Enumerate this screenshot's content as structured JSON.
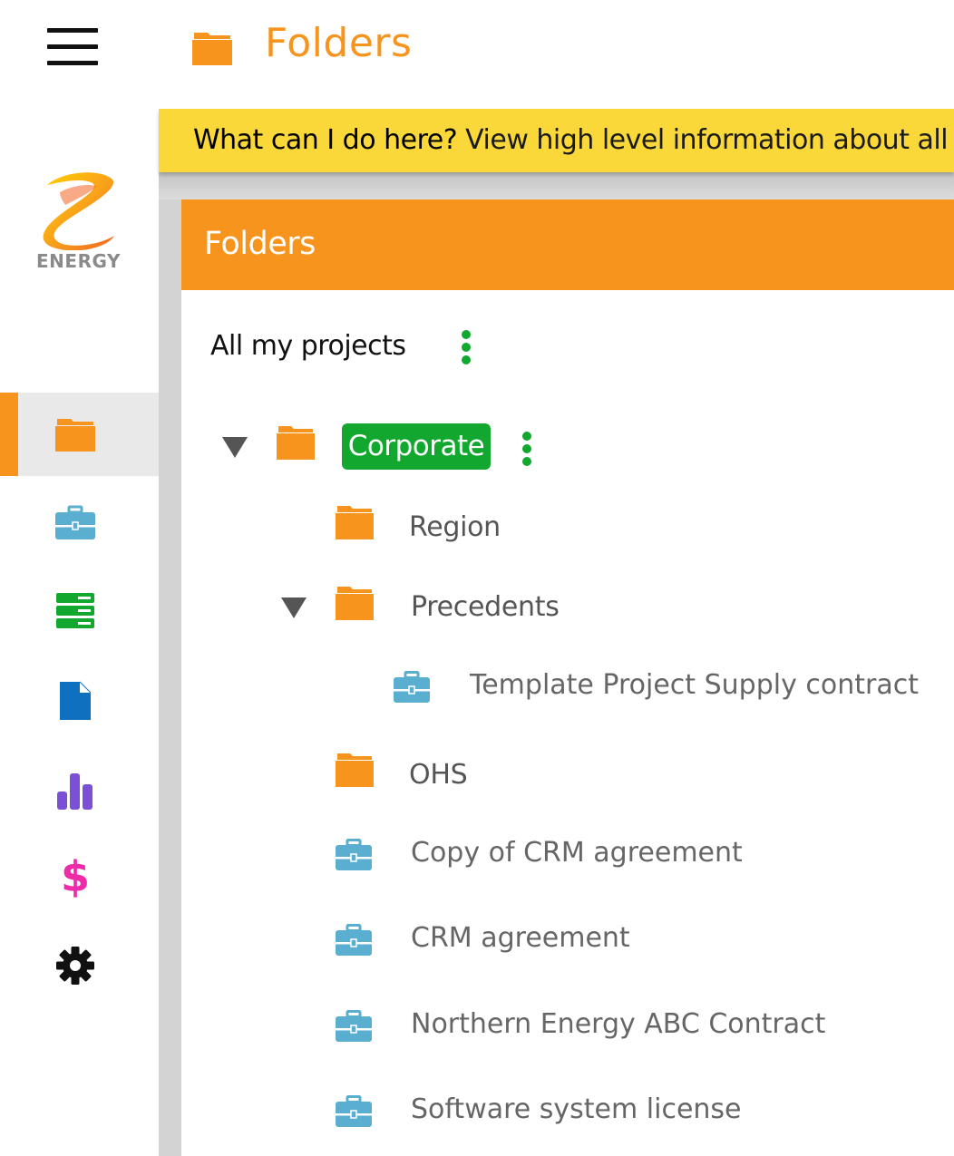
{
  "header": {
    "title": "Folders",
    "folder_icon": "folder-icon",
    "menu_icon": "hamburger-icon"
  },
  "brand": {
    "logo_text": "ENERGY",
    "accent_color": "#f7941d"
  },
  "sidebar": {
    "items": [
      {
        "name": "folders",
        "icon": "folder-icon",
        "color": "#f7941d",
        "active": true
      },
      {
        "name": "projects",
        "icon": "briefcase-icon",
        "color": "#5aaed0",
        "active": false
      },
      {
        "name": "storage",
        "icon": "server-icon",
        "color": "#12a82f",
        "active": false
      },
      {
        "name": "documents",
        "icon": "document-icon",
        "color": "#1070c0",
        "active": false
      },
      {
        "name": "reports",
        "icon": "bar-chart-icon",
        "color": "#7b4fd6",
        "active": false
      },
      {
        "name": "billing",
        "icon": "dollar-icon",
        "color": "#ee2ba8",
        "active": false
      },
      {
        "name": "settings",
        "icon": "gear-icon",
        "color": "#111111",
        "active": false
      }
    ]
  },
  "banner": {
    "question": "What can I do here?",
    "text": " View high level information about all pro"
  },
  "panel": {
    "title": "Folders",
    "root_label": "All my projects"
  },
  "tree": {
    "corporate": {
      "label": "Corporate",
      "expanded": true,
      "chip_color": "#12a82f"
    },
    "region": {
      "label": "Region"
    },
    "precedents": {
      "label": "Precedents",
      "expanded": true
    },
    "template_project": {
      "label": "Template Project Supply contract"
    },
    "ohs": {
      "label": "OHS"
    },
    "projects": [
      {
        "label": "Copy of CRM agreement"
      },
      {
        "label": "CRM agreement"
      },
      {
        "label": "Northern Energy ABC Contract"
      },
      {
        "label": "Software system license"
      }
    ]
  }
}
